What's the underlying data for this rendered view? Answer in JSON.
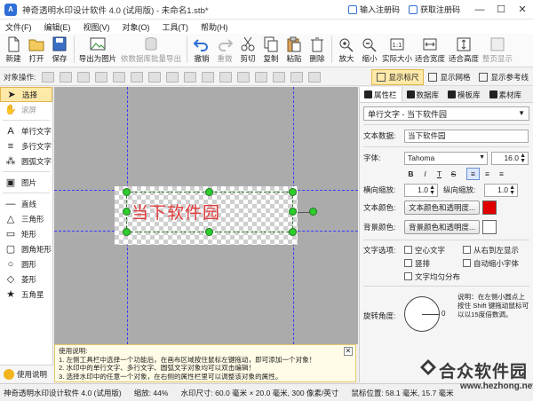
{
  "window": {
    "title": "神奇透明水印设计软件 4.0 (试用版) - 未命名1.stb*",
    "register_label": "输入注册码",
    "get_code_label": "获取注册码"
  },
  "menu": [
    "文件(F)",
    "编辑(E)",
    "视图(V)",
    "对象(O)",
    "工具(T)",
    "帮助(H)"
  ],
  "toolbar": {
    "new": "新建",
    "open": "打开",
    "save": "保存",
    "export_image": "导出为图片",
    "batch_export": "依数据库批量导出",
    "undo": "撤销",
    "redo": "重做",
    "cut": "剪切",
    "copy": "复制",
    "paste": "粘贴",
    "delete": "删除",
    "zoom_in": "放大",
    "zoom_out": "缩小",
    "actual_size": "实际大小",
    "fit_width": "适合宽度",
    "fit_height": "适合高度",
    "full_page": "整页显示"
  },
  "objbar": {
    "label": "对象操作:",
    "show_ruler": "显示标尺",
    "show_grid": "显示网格",
    "show_guides": "显示参考线"
  },
  "palette": {
    "select": "选择",
    "scroll": "滚屏",
    "single_text": "单行文字",
    "multi_text": "多行文字",
    "circle_text": "圆弧文字",
    "image": "图片",
    "line": "直线",
    "triangle": "三角形",
    "rectangle": "矩形",
    "rounded_rect": "圆角矩形",
    "circle": "圆形",
    "diamond": "菱形",
    "star": "五角星",
    "help": "使用说明"
  },
  "canvas": {
    "text": "当下软件园",
    "text_color": "#e23b3b"
  },
  "helpbox": {
    "title": "使用说明:",
    "line1": "1. 左侧工具栏中选择一个功能后，在画布区域按住鼠标左键拖动，即可添加一个对象！",
    "line2": "2. 水印中的单行文字、多行文字、圆弧文字对象均可以双击编辑！",
    "line3": "3. 选择水印中的任意一个对象，在右侧的属性栏里可以调整该对象的属性。"
  },
  "panel": {
    "tabs": [
      "属性栏",
      "数据库",
      "模板库",
      "素材库"
    ],
    "object_select": "单行文字 - 当下软件园",
    "text_data_label": "文本数据:",
    "text_data_value": "当下软件园",
    "font_label": "字体:",
    "font_value": "Tahoma",
    "font_size": "16.0",
    "hscale_label": "横向缩放:",
    "hscale_value": "1.0",
    "vscale_label": "纵向缩放:",
    "vscale_value": "1.0",
    "text_color_label": "文本颜色:",
    "text_color_btn": "文本颜色和透明度...",
    "text_color": "#e10000",
    "bg_color_label": "背景颜色:",
    "bg_color_btn": "背景颜色和透明度...",
    "bg_color": "#ffffff",
    "options_label": "文字选项:",
    "opt_hollow": "空心文字",
    "opt_rtl": "从右到左显示",
    "opt_vertical": "竖排",
    "opt_autoshrink": "自动缩小字体",
    "opt_distribute": "文字均匀分布",
    "rotation_label": "旋转角度:",
    "rotation_value": "0",
    "rotation_note": "说明：在左侧小圆点上按住 Shift 键拖动鼠标可以以15度倍数调。"
  },
  "status": {
    "app": "神奇透明水印设计软件 4.0 (试用版)",
    "zoom": "缩放: 44%",
    "size": "水印尺寸: 60.0 毫米 × 20.0 毫米, 300 像素/英寸",
    "pos": "鼠标位置: 58.1 毫米, 15.7 毫米"
  },
  "watermark": {
    "text": "合众软件园",
    "url": "www.hezhong.net"
  }
}
